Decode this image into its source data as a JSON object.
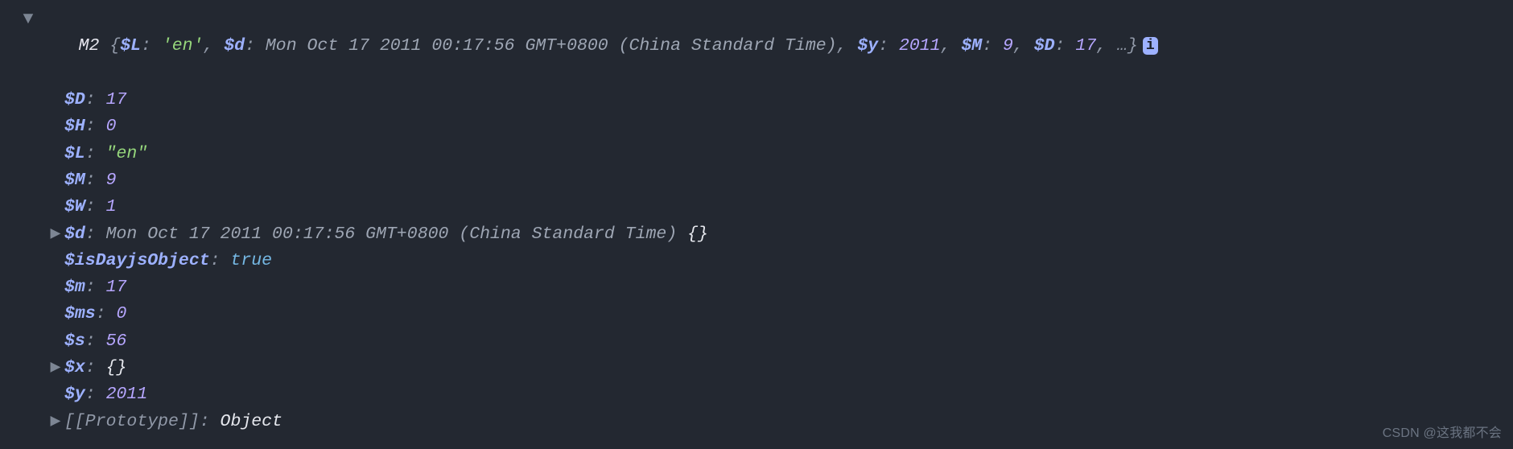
{
  "summary": {
    "class_name": "M2",
    "open_brace": "{",
    "close_brace": "}",
    "ellipsis": "…",
    "entries": [
      {
        "key": "$L",
        "val": "'en'",
        "kind": "str"
      },
      {
        "key": "$d",
        "val": "Mon Oct 17 2011 00:17:56 GMT+0800 (China Standard Time)",
        "kind": "date"
      },
      {
        "key": "$y",
        "val": "2011",
        "kind": "num"
      },
      {
        "key": "$M",
        "val": "9",
        "kind": "num"
      },
      {
        "key": "$D",
        "val": "17",
        "kind": "num"
      }
    ]
  },
  "info_badge": "i",
  "props": {
    "D": {
      "key": "$D",
      "val": "17",
      "kind": "num"
    },
    "H": {
      "key": "$H",
      "val": "0",
      "kind": "num"
    },
    "L": {
      "key": "$L",
      "val": "\"en\"",
      "kind": "str"
    },
    "M": {
      "key": "$M",
      "val": "9",
      "kind": "num"
    },
    "W": {
      "key": "$W",
      "val": "1",
      "kind": "num"
    },
    "d": {
      "key": "$d",
      "val": "Mon Oct 17 2011 00:17:56 GMT+0800 (China Standard Time)",
      "kind": "date",
      "suffix": " {}"
    },
    "isDayjsObject": {
      "key": "$isDayjsObject",
      "val": "true",
      "kind": "bool"
    },
    "m": {
      "key": "$m",
      "val": "17",
      "kind": "num"
    },
    "ms": {
      "key": "$ms",
      "val": "0",
      "kind": "num"
    },
    "s": {
      "key": "$s",
      "val": "56",
      "kind": "num"
    },
    "x": {
      "key": "$x",
      "val": "{}",
      "kind": "plain"
    },
    "y": {
      "key": "$y",
      "val": "2011",
      "kind": "num"
    }
  },
  "proto": {
    "key": "[[Prototype]]",
    "val": "Object"
  },
  "glyphs": {
    "arrow_down": "▼",
    "arrow_right": "▶"
  },
  "watermark": "CSDN @这我都不会"
}
